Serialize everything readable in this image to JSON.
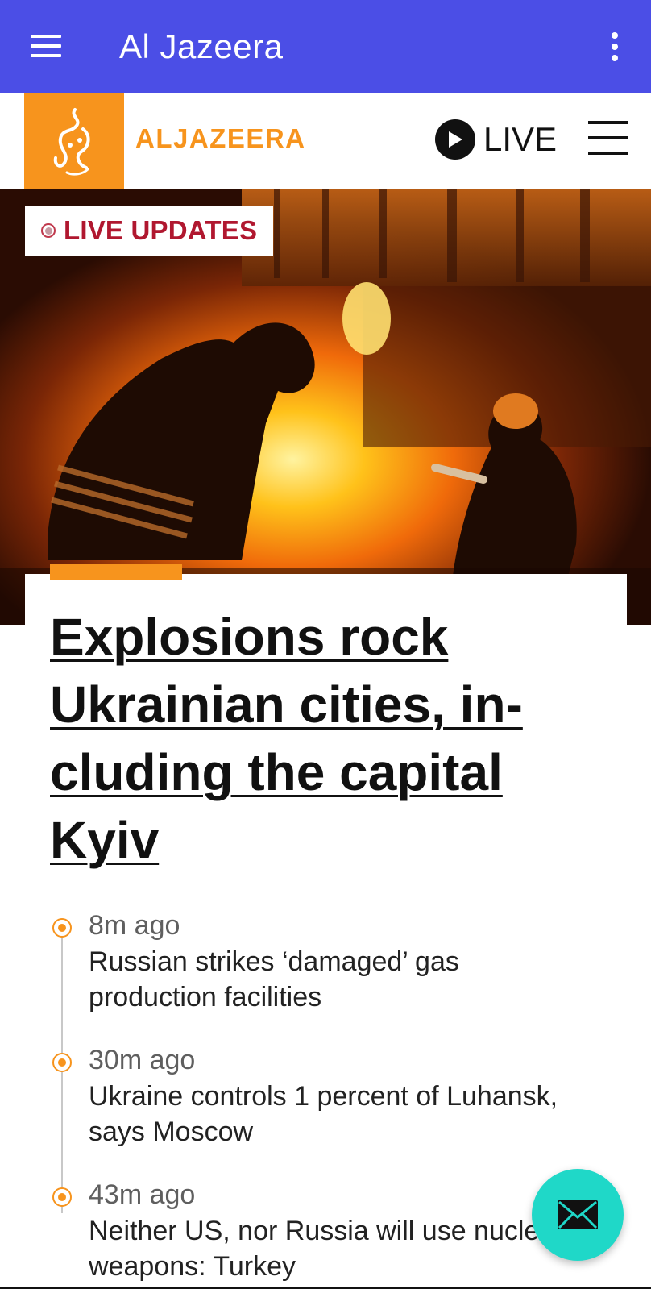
{
  "appbar": {
    "title": "Al Jazeera"
  },
  "site": {
    "logo_text": "ALJAZEERA",
    "live_label": "LIVE"
  },
  "hero": {
    "badge": "LIVE UPDATES"
  },
  "article": {
    "headline": "Explosions rock Ukrainian cities, in-cluding the capital Kyiv"
  },
  "timeline": [
    {
      "time": "8m ago",
      "text": "Russian strikes ‘damaged’ gas production facilities"
    },
    {
      "time": "30m ago",
      "text": "Ukraine controls 1 percent of Luhansk, says Moscow"
    },
    {
      "time": "43m ago",
      "text": "Neither US, nor Russia will use nuclear weapons: Turkey"
    }
  ],
  "colors": {
    "appbar": "#4b4ee6",
    "brand": "#f7941d",
    "live_red": "#b0172f",
    "fab": "#1fd8c8"
  },
  "icons": {
    "nav": "hamburger-icon",
    "more": "more-vert-icon",
    "play": "play-icon",
    "site_menu": "menu-icon",
    "fab": "mail-icon"
  }
}
